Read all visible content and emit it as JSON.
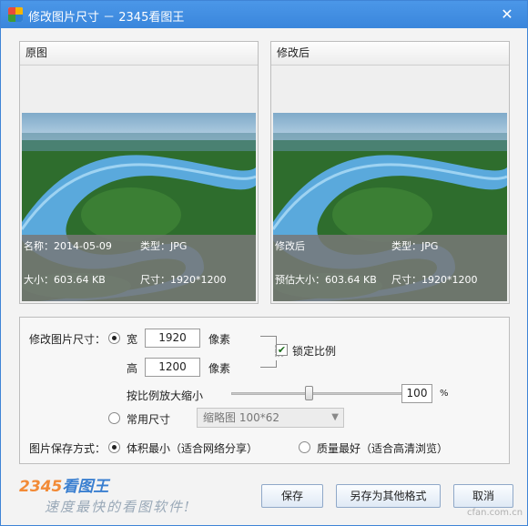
{
  "window": {
    "title": "修改图片尺寸 － 2345看图王",
    "close_glyph": "✕"
  },
  "original_panel": {
    "header": "原图",
    "name": "名称：2014-05-09",
    "type": "类型：JPG",
    "size": "大小：603.64 KB",
    "dimensions": "尺寸：1920*1200"
  },
  "modified_panel": {
    "header": "修改后",
    "name": "修改后",
    "type": "类型：JPG",
    "size": "预估大小：603.64 KB",
    "dimensions": "尺寸：1920*1200"
  },
  "resize": {
    "label": "修改图片尺寸：",
    "width_label": "宽",
    "width_value": "1920",
    "width_unit": "像素",
    "height_label": "高",
    "height_value": "1200",
    "height_unit": "像素",
    "lock_ratio_label": "锁定比例",
    "lock_ratio_checked": true,
    "scale_label": "按比例放大缩小",
    "scale_value": "100",
    "scale_unit": "%",
    "slider_fraction": 0.43,
    "common_size_label": "常用尺寸",
    "common_size_selected": "缩略图 100*62"
  },
  "save_mode": {
    "label": "图片保存方式：",
    "option_small": "体积最小（适合网络分享）",
    "option_quality": "质量最好（适合高清浏览）",
    "selected": "small"
  },
  "buttons": {
    "save": "保存",
    "save_as": "另存为其他格式",
    "cancel": "取消"
  },
  "branding": {
    "logo_num": "2345",
    "logo_cn": "看图王",
    "slogan": "速度最快的看图软件!",
    "watermark": "cfan.com.cn"
  },
  "icons": {
    "app": "app-icon",
    "close": "close-icon",
    "chain": "chain-link-icon",
    "dropdown": "chevron-down-icon"
  },
  "colors": {
    "titlebar": "#3a86dc",
    "button_border": "#8fa8c8",
    "logo_orange": "#f28a36",
    "logo_blue": "#3a7fd0"
  }
}
